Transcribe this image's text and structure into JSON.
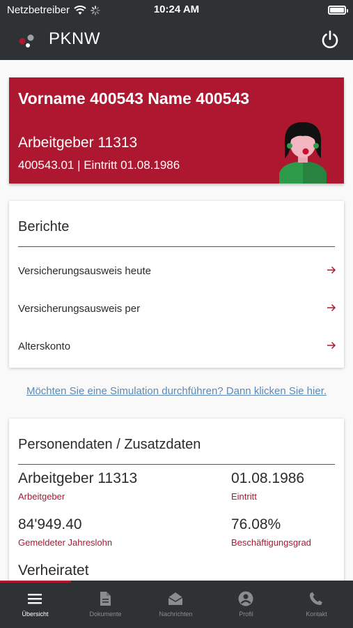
{
  "status_bar": {
    "carrier": "Netzbetreiber",
    "time": "10:24 AM",
    "battery_level_percent": 100
  },
  "header": {
    "app_title": "PKNW",
    "logo_icon": "pknw-dots-logo",
    "power_icon": "power-icon"
  },
  "colors": {
    "brand_red": "#ad1730",
    "dark_bar": "#2f3234",
    "link_blue": "#5b89b8"
  },
  "profile": {
    "name": "Vorname 400543 Name 400543",
    "employer": "Arbeitgeber 11313",
    "meta": "400543.01 | Eintritt 01.08.1986"
  },
  "reports": {
    "title": "Berichte",
    "items": [
      {
        "label": "Versicherungsausweis heute",
        "icon": "arrow-right-icon"
      },
      {
        "label": "Versicherungsausweis per",
        "icon": "arrow-right-icon"
      },
      {
        "label": "Alterskonto",
        "icon": "arrow-right-icon"
      }
    ]
  },
  "simulation_link": "Möchten Sie eine Simulation durchführen? Dann klicken Sie hier.",
  "personal": {
    "title": "Personendaten / Zusatzdaten",
    "fields": [
      {
        "value": "Arbeitgeber 11313",
        "label": "Arbeitgeber"
      },
      {
        "value": "01.08.1986",
        "label": "Eintritt"
      },
      {
        "value": "84'949.40",
        "label": "Gemeldeter Jahreslohn"
      },
      {
        "value": "76.08%",
        "label": "Beschäftigungsgrad"
      },
      {
        "value": "Verheiratet",
        "label": ""
      }
    ]
  },
  "tabs": [
    {
      "label": "Übersicht",
      "icon": "menu-icon",
      "active": true
    },
    {
      "label": "Dokumente",
      "icon": "document-icon",
      "active": false
    },
    {
      "label": "Nachrichten",
      "icon": "mail-open-icon",
      "active": false
    },
    {
      "label": "Profil",
      "icon": "profile-icon",
      "active": false
    },
    {
      "label": "Kontakt",
      "icon": "phone-icon",
      "active": false
    }
  ]
}
